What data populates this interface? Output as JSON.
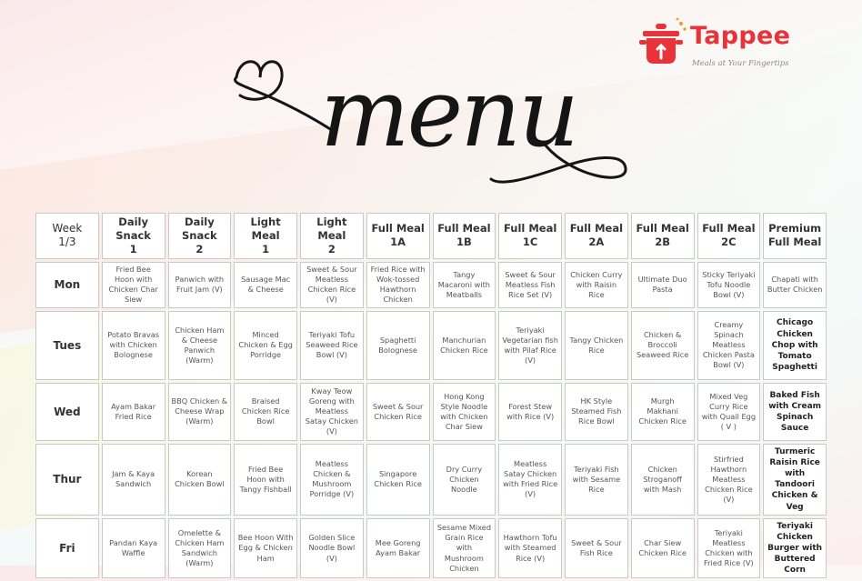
{
  "brand": {
    "name": "Tappee",
    "tagline": "Meals at Your Fingertips",
    "color": "#e8333a"
  },
  "title": "menu",
  "table": {
    "corner": [
      "Week",
      "1/3"
    ],
    "columns": [
      [
        "Daily Snack",
        "1"
      ],
      [
        "Daily Snack",
        "2"
      ],
      [
        "Light Meal",
        "1"
      ],
      [
        "Light Meal",
        "2"
      ],
      [
        "Full Meal",
        "1A"
      ],
      [
        "Full Meal",
        "1B"
      ],
      [
        "Full Meal",
        "1C"
      ],
      [
        "Full Meal",
        "2A"
      ],
      [
        "Full Meal",
        "2B"
      ],
      [
        "Full Meal",
        "2C"
      ],
      [
        "Premium",
        "Full Meal"
      ]
    ],
    "rows": [
      {
        "day": "Mon",
        "cells": [
          "Fried Bee Hoon with Chicken Char Siew",
          "Panwich with Fruit Jam (V)",
          "Sausage Mac & Cheese",
          "Sweet & Sour Meatless Chicken Rice (V)",
          "Fried Rice with Wok-tossed Hawthorn Chicken",
          "Tangy Macaroni with Meatballs",
          "Sweet & Sour Meatless Fish Rice Set (V)",
          "Chicken Curry with Raisin Rice",
          "Ultimate Duo Pasta",
          "Sticky Teriyaki Tofu Noodle Bowl (V)",
          "Chapati with Butter Chicken"
        ]
      },
      {
        "day": "Tues",
        "cells": [
          "Potato Bravas with Chicken Bolognese",
          "Chicken Ham & Cheese Panwich (Warm)",
          "Minced Chicken & Egg Porridge",
          "Teriyaki Tofu Seaweed Rice Bowl (V)",
          "Spaghetti Bolognese",
          "Manchurian Chicken Rice",
          "Teriyaki Vegetarian fish with Pilaf Rice (V)",
          "Tangy Chicken Rice",
          "Chicken & Broccoli Seaweed Rice",
          "Creamy Spinach Meatless Chicken Pasta Bowl (V)",
          "Chicago Chicken Chop with Tomato Spaghetti"
        ]
      },
      {
        "day": "Wed",
        "cells": [
          "Ayam Bakar Fried Rice",
          "BBQ Chicken & Cheese Wrap (Warm)",
          "Braised Chicken Rice Bowl",
          "Kway Teow Goreng with Meatless Satay Chicken (V)",
          "Sweet & Sour Chicken Rice",
          "Hong Kong Style Noodle with Chicken Char Siew",
          "Forest Stew with Rice (V)",
          "HK Style Steamed Fish Rice Bowl",
          "Murgh Makhani Chicken Rice",
          "Mixed Veg Curry Rice with Quail Egg ( V )",
          "Baked Fish with Cream Spinach Sauce"
        ]
      },
      {
        "day": "Thur",
        "cells": [
          "Jam & Kaya Sandwich",
          "Korean Chicken Bowl",
          "Fried Bee Hoon with Tangy Fishball",
          "Meatless Chicken & Mushroom Porridge (V)",
          "Singapore Chicken Rice",
          "Dry Curry Chicken Noodle",
          "Meatless Satay Chicken with Fried Rice (V)",
          "Teriyaki Fish with Sesame Rice",
          "Chicken Stroganoff with Mash",
          "Stirfried Hawthorn Meatless Chicken Rice (V)",
          "Turmeric Raisin Rice with Tandoori Chicken & Veg"
        ]
      },
      {
        "day": "Fri",
        "cells": [
          "Pandan Kaya Waffle",
          "Omelette & Chicken Ham Sandwich (Warm)",
          "Bee Hoon With Egg & Chicken Ham",
          "Golden Slice Noodle Bowl (V)",
          "Mee Goreng Ayam Bakar",
          "Sesame Mixed Grain Rice with Mushroom Chicken",
          "Hawthorn Tofu with Steamed Rice (V)",
          "Sweet & Sour Fish Rice",
          "Char Siew Chicken Rice",
          "Teriyaki Meatless Chicken with Fried Rice (V)",
          "Teriyaki Chicken Burger with Buttered Corn"
        ]
      }
    ]
  }
}
